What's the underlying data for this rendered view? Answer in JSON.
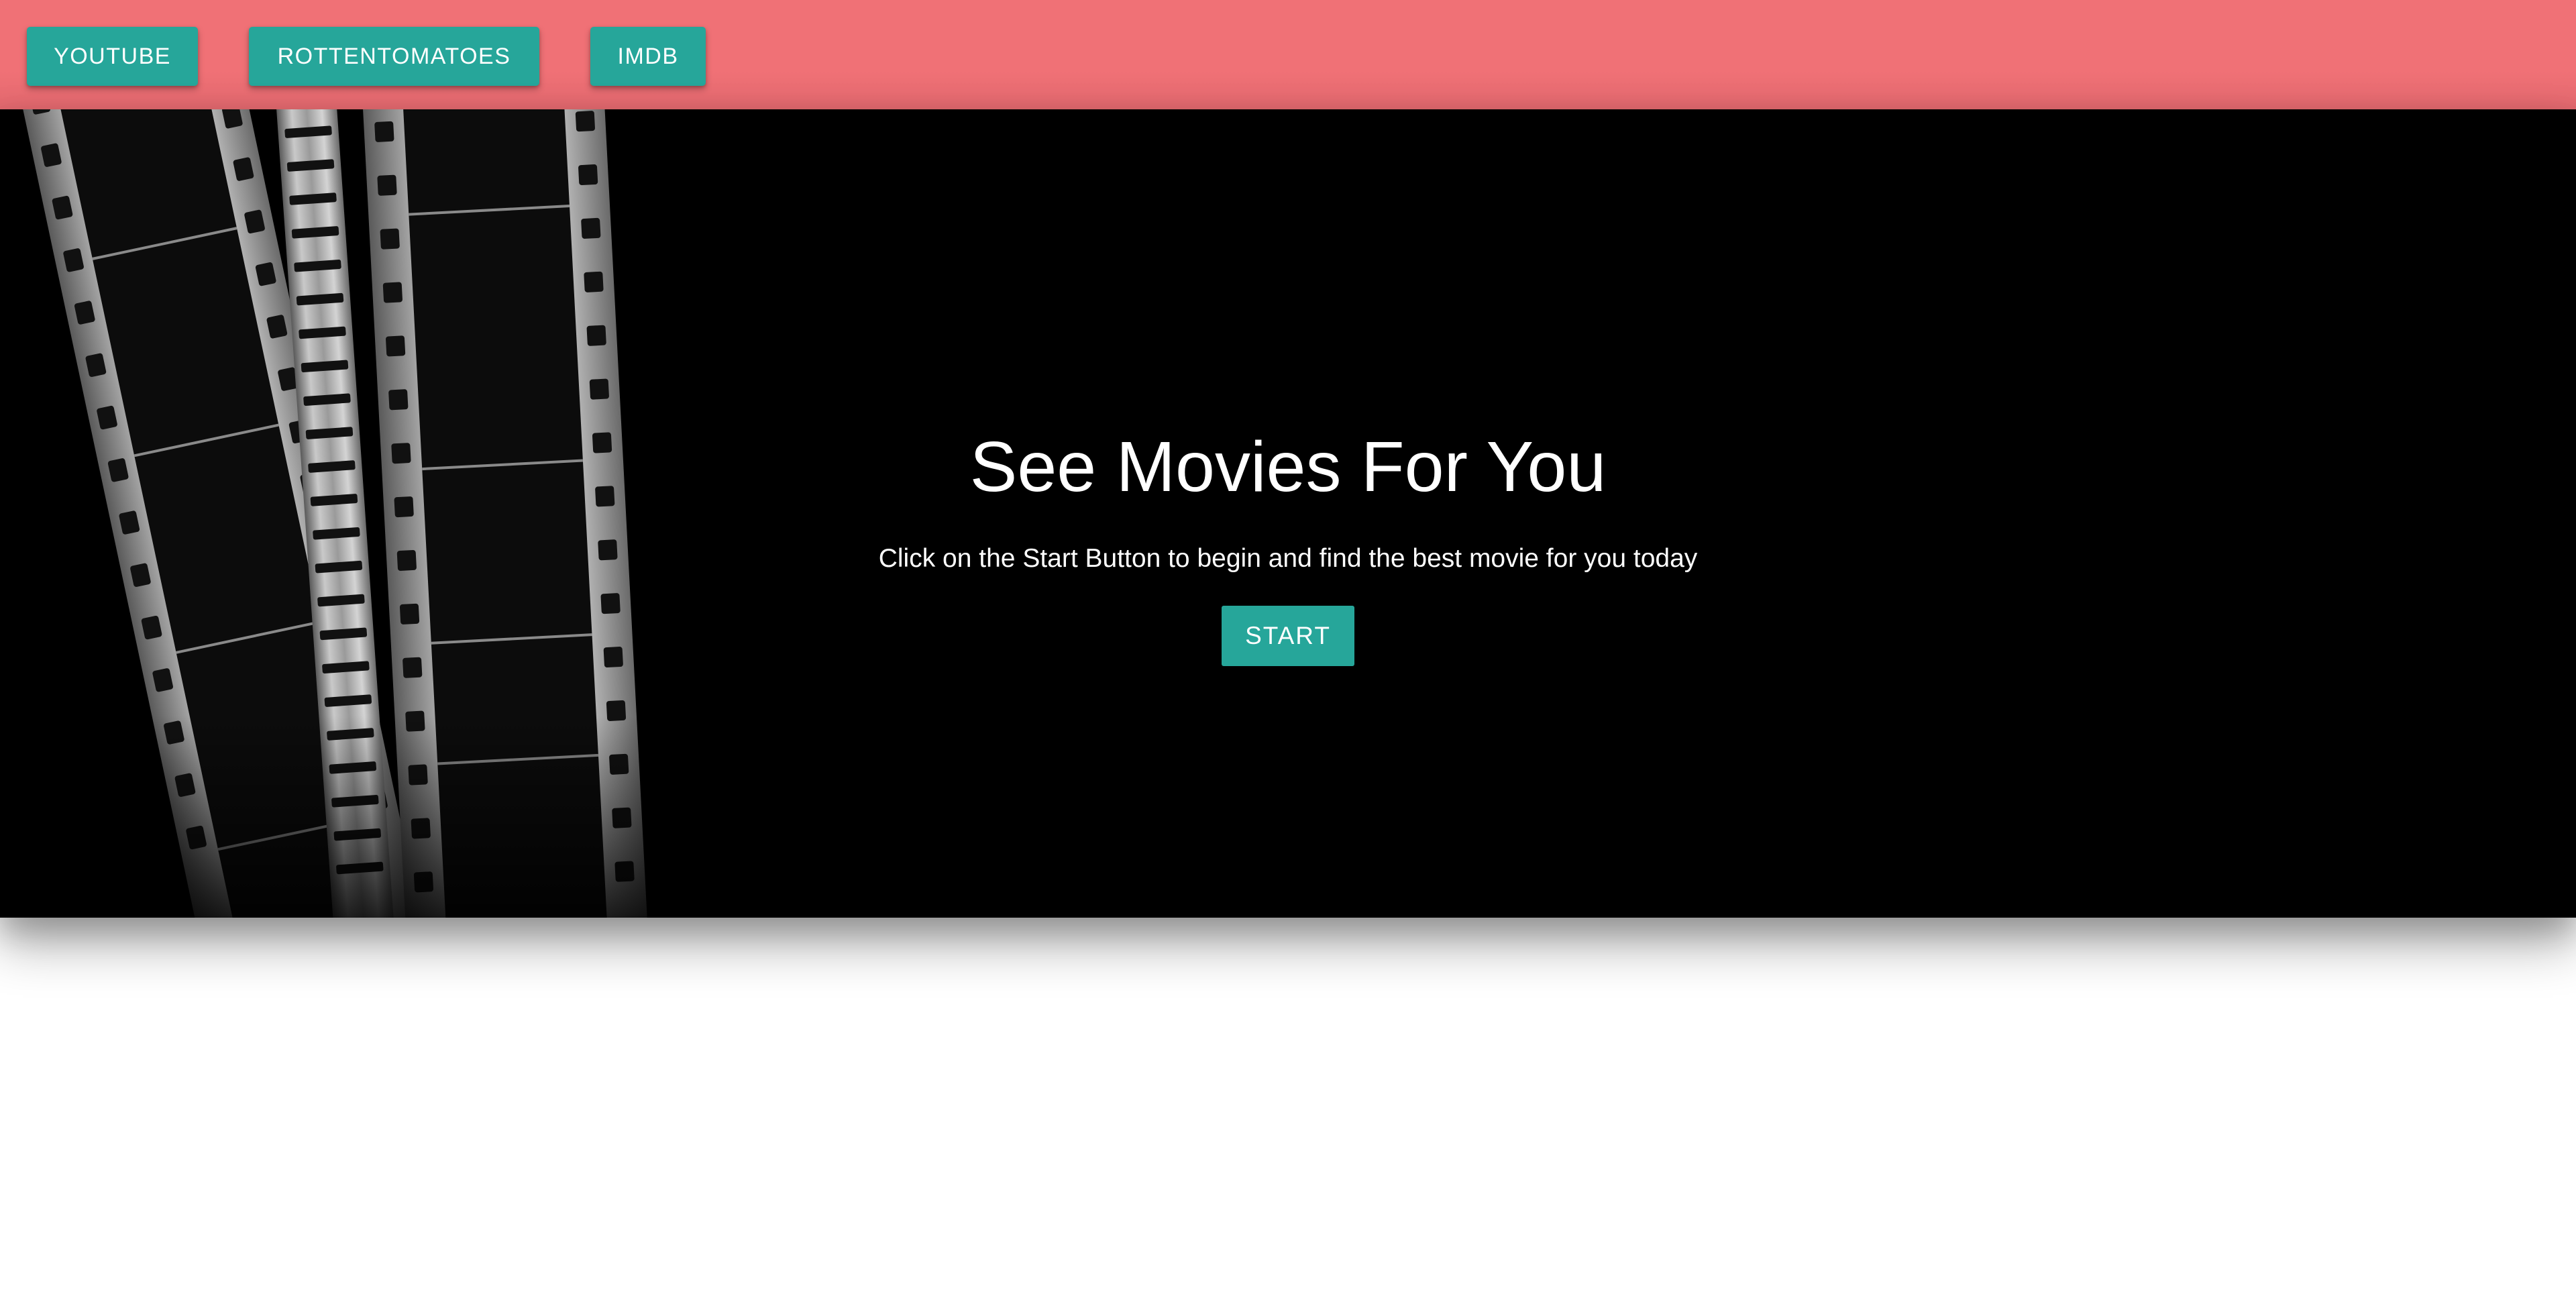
{
  "nav": {
    "buttons": [
      {
        "label": "YOUTUBE"
      },
      {
        "label": "ROTTENTOMATOES"
      },
      {
        "label": "IMDB"
      }
    ]
  },
  "hero": {
    "title": "See Movies For You",
    "subtitle": "Click on the Start Button to begin and find the best movie for you today",
    "start_label": "START",
    "background_image": "film-strip-reels"
  },
  "colors": {
    "navbar": "#f07176",
    "button": "#26a69a",
    "hero_bg": "#000000",
    "text": "#ffffff"
  }
}
